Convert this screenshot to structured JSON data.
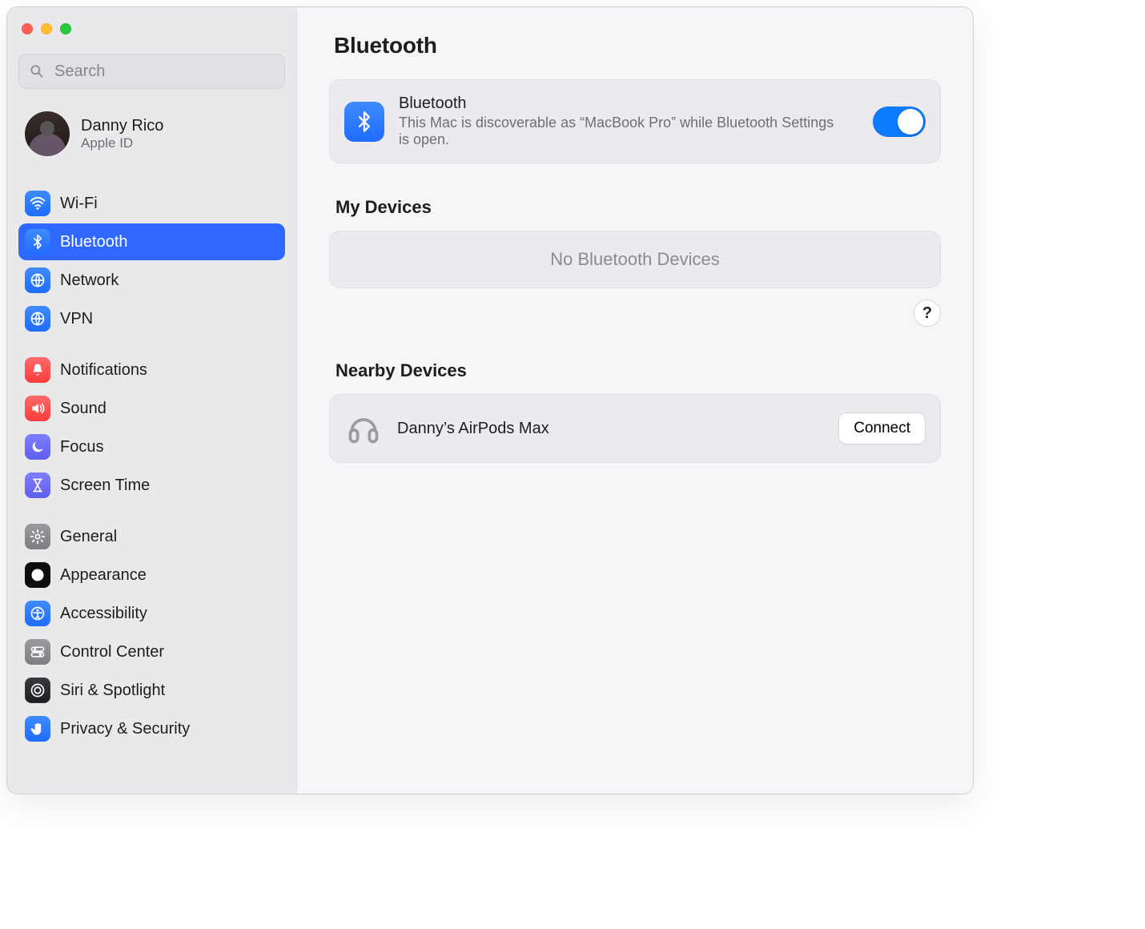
{
  "search": {
    "placeholder": "Search"
  },
  "account": {
    "name": "Danny Rico",
    "sub": "Apple ID"
  },
  "sidebar": {
    "group1": [
      {
        "label": "Wi-Fi",
        "icon": "wifi",
        "color": "blue",
        "selected": false
      },
      {
        "label": "Bluetooth",
        "icon": "bluetooth",
        "color": "blue",
        "selected": true
      },
      {
        "label": "Network",
        "icon": "globe",
        "color": "blue",
        "selected": false
      },
      {
        "label": "VPN",
        "icon": "globe",
        "color": "blue",
        "selected": false
      }
    ],
    "group2": [
      {
        "label": "Notifications",
        "icon": "bell",
        "color": "red"
      },
      {
        "label": "Sound",
        "icon": "sound",
        "color": "red"
      },
      {
        "label": "Focus",
        "icon": "moon",
        "color": "purple"
      },
      {
        "label": "Screen Time",
        "icon": "hourglass",
        "color": "purple"
      }
    ],
    "group3": [
      {
        "label": "General",
        "icon": "gear",
        "color": "gray"
      },
      {
        "label": "Appearance",
        "icon": "appear",
        "color": "black"
      },
      {
        "label": "Accessibility",
        "icon": "access",
        "color": "blue"
      },
      {
        "label": "Control Center",
        "icon": "switches",
        "color": "gray"
      },
      {
        "label": "Siri & Spotlight",
        "icon": "siri",
        "color": "dark"
      },
      {
        "label": "Privacy & Security",
        "icon": "hand",
        "color": "blue"
      }
    ]
  },
  "main": {
    "title": "Bluetooth",
    "bt": {
      "heading": "Bluetooth",
      "description": "This Mac is discoverable as “MacBook Pro” while Bluetooth Settings is open.",
      "enabled": true
    },
    "myDevices": {
      "heading": "My Devices",
      "empty": "No Bluetooth Devices"
    },
    "help_label": "?",
    "nearby": {
      "heading": "Nearby Devices",
      "devices": [
        {
          "name": "Danny’s AirPods Max",
          "action": "Connect"
        }
      ]
    }
  }
}
